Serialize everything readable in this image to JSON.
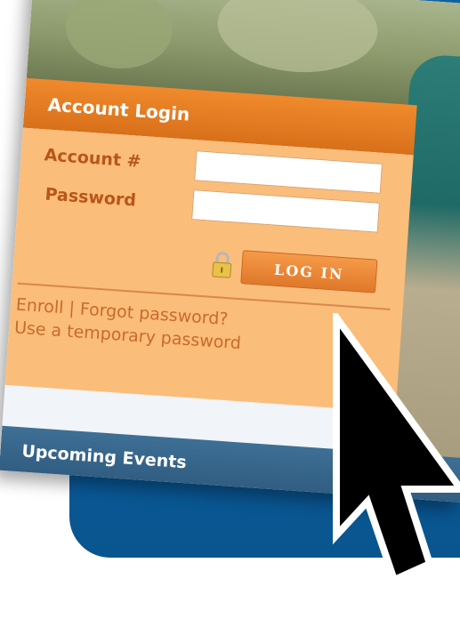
{
  "login": {
    "title": "Account Login",
    "account_label": "Account #",
    "password_label": "Password",
    "account_value": "",
    "password_value": "",
    "button_label": "LOG IN",
    "enroll_link": "Enroll",
    "separator": "|",
    "forgot_link": "Forgot password?",
    "temp_link": "Use a temporary password"
  },
  "events": {
    "title": "Upcoming Events"
  },
  "colors": {
    "brand_blue": "#0a5c9e",
    "login_orange": "#e0782a",
    "login_panel": "#fbbd7a",
    "events_header": "#305c80"
  },
  "icons": {
    "lock": "lock-icon",
    "cursor": "mouse-pointer-icon"
  }
}
